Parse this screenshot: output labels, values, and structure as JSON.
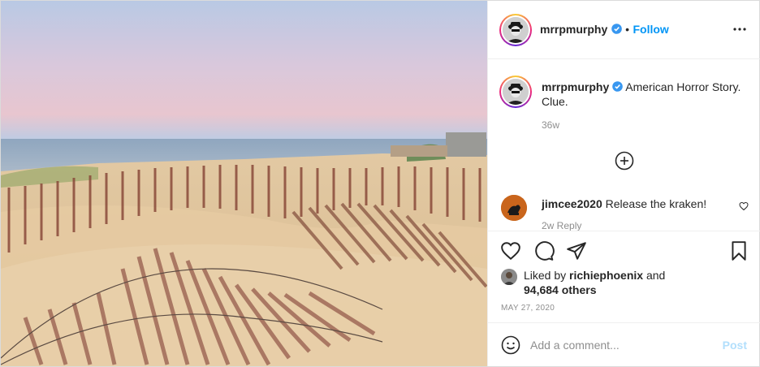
{
  "post": {
    "author": {
      "username": "mrrpmurphy",
      "verified": true,
      "avatar_icon": "profile-photo"
    },
    "header": {
      "separator": "•",
      "follow_label": "Follow",
      "more_icon": "more-horizontal-icon"
    },
    "caption": {
      "username": "mrrpmurphy",
      "text": "American Horror Story. Clue.",
      "age": "36w"
    },
    "load_more_icon": "plus-circle-icon",
    "comments": [
      {
        "username": "jimcee2020",
        "text": "Release the kraken!",
        "meta": "2w   Reply"
      }
    ],
    "actions": {
      "like_icon": "heart-icon",
      "comment_icon": "comment-bubble-icon",
      "share_icon": "paper-plane-icon",
      "save_icon": "bookmark-icon"
    },
    "likes": {
      "prefix": "Liked by ",
      "liker": "richiephoenix",
      "conjunction": " and",
      "others": "94,684 others"
    },
    "date": "MAY 27, 2020",
    "add_comment": {
      "placeholder": "Add a comment...",
      "post_label": "Post",
      "emoji_icon": "smiley-icon"
    },
    "colors": {
      "accent": "#0095f6",
      "post_disabled": "#b2dffc",
      "muted": "#8e8e8e",
      "text": "#262626"
    }
  }
}
